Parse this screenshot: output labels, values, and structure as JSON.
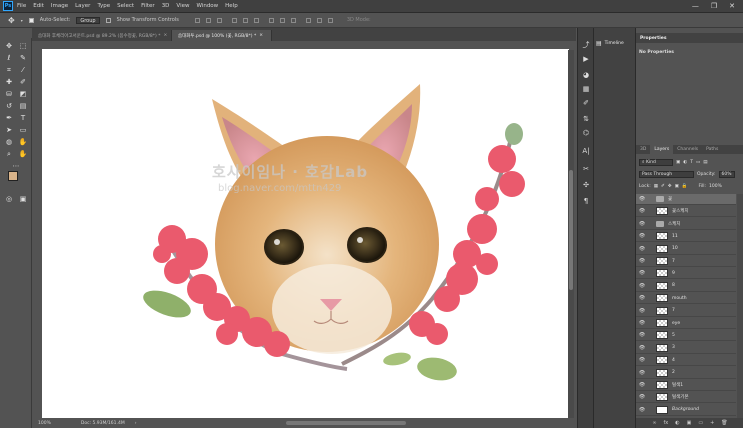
{
  "app": {
    "logo": "Ps",
    "menus": [
      "File",
      "Edit",
      "Image",
      "Layer",
      "Type",
      "Select",
      "Filter",
      "3D",
      "View",
      "Window",
      "Help"
    ],
    "window_controls": [
      "—",
      "❐",
      "✕"
    ]
  },
  "options_bar": {
    "auto_select_label": "Auto-Select:",
    "auto_select_value": "Group",
    "show_transform_label": "Show Transform Controls",
    "mode_3d": "3D Mode:"
  },
  "tabs": [
    {
      "label": "슴대화 후체리아고서운트.psd @ 89.2% (봄수정꽃, RGB/8*) *",
      "close": "×"
    },
    {
      "label": "슴대화투.psd @ 100% (꽃, RGB/8*) *",
      "close": "×"
    }
  ],
  "canvas": {
    "watermark_text": "호사이임나 · 호감Lab",
    "watermark_url": "blog.naver.com/mttn429"
  },
  "status": {
    "zoom": "100%",
    "doc": "Doc: 5.93M/161.4M",
    "arrow": "›"
  },
  "side_strip": {
    "timeline_label": "Timeline"
  },
  "properties": {
    "title": "Properties",
    "body": "No Properties"
  },
  "layers_panel": {
    "tabs": [
      "3D",
      "Layers",
      "Channels",
      "Paths"
    ],
    "kind_label": "Kind",
    "blend_mode": "Pass Through",
    "opacity_label": "Opacity:",
    "opacity_value": "60%",
    "lock_label": "Lock:",
    "fill_label": "Fill:",
    "fill_value": "100%",
    "layers": [
      {
        "name": "꽃",
        "type": "folder",
        "selected": true
      },
      {
        "name": "꽃스케치",
        "type": "layer",
        "selected": false
      },
      {
        "name": "스케치",
        "type": "folder",
        "selected": false
      },
      {
        "name": "11",
        "type": "layer",
        "selected": false
      },
      {
        "name": "10",
        "type": "layer",
        "selected": false
      },
      {
        "name": "7",
        "type": "layer",
        "selected": false
      },
      {
        "name": "9",
        "type": "layer",
        "selected": false
      },
      {
        "name": "8",
        "type": "layer",
        "selected": false
      },
      {
        "name": "mouth",
        "type": "layer",
        "selected": false
      },
      {
        "name": "7",
        "type": "layer",
        "selected": false
      },
      {
        "name": "eye",
        "type": "layer",
        "selected": false
      },
      {
        "name": "5",
        "type": "layer",
        "selected": false
      },
      {
        "name": "3",
        "type": "layer",
        "selected": false
      },
      {
        "name": "4",
        "type": "layer",
        "selected": false
      },
      {
        "name": "2",
        "type": "layer",
        "selected": false
      },
      {
        "name": "털색1",
        "type": "layer",
        "selected": false
      },
      {
        "name": "털색기본",
        "type": "layer",
        "selected": false
      },
      {
        "name": "Background",
        "type": "background",
        "selected": false
      }
    ],
    "footer_icons": [
      "∞",
      "fx",
      "◐",
      "▣",
      "▭",
      "+",
      "🗑"
    ]
  },
  "colors": {
    "foreground": "#d9b48a",
    "background": "#ffffff"
  }
}
